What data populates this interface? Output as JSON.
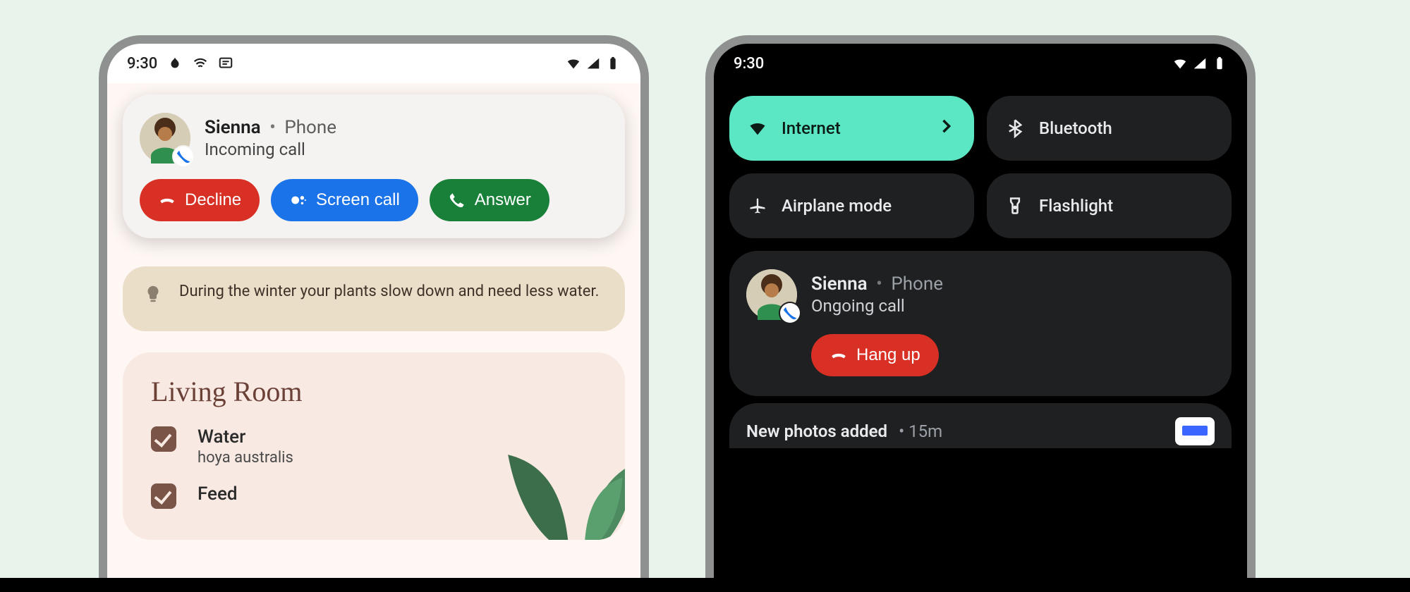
{
  "status": {
    "time": "9:30"
  },
  "left": {
    "call": {
      "caller": "Sienna",
      "app": "Phone",
      "status": "Incoming call",
      "decline": "Decline",
      "screen": "Screen call",
      "answer": "Answer"
    },
    "tip": "During the winter your plants slow down and need less water.",
    "room": {
      "title": "Living Room",
      "tasks": [
        {
          "primary": "Water",
          "secondary": "hoya australis"
        },
        {
          "primary": "Feed",
          "secondary": ""
        }
      ]
    }
  },
  "right": {
    "tiles": {
      "internet": "Internet",
      "bluetooth": "Bluetooth",
      "airplane": "Airplane mode",
      "flashlight": "Flashlight"
    },
    "call": {
      "caller": "Sienna",
      "app": "Phone",
      "status": "Ongoing call",
      "hangup": "Hang up"
    },
    "peek": {
      "title": "New photos added",
      "meta": "15m"
    }
  }
}
